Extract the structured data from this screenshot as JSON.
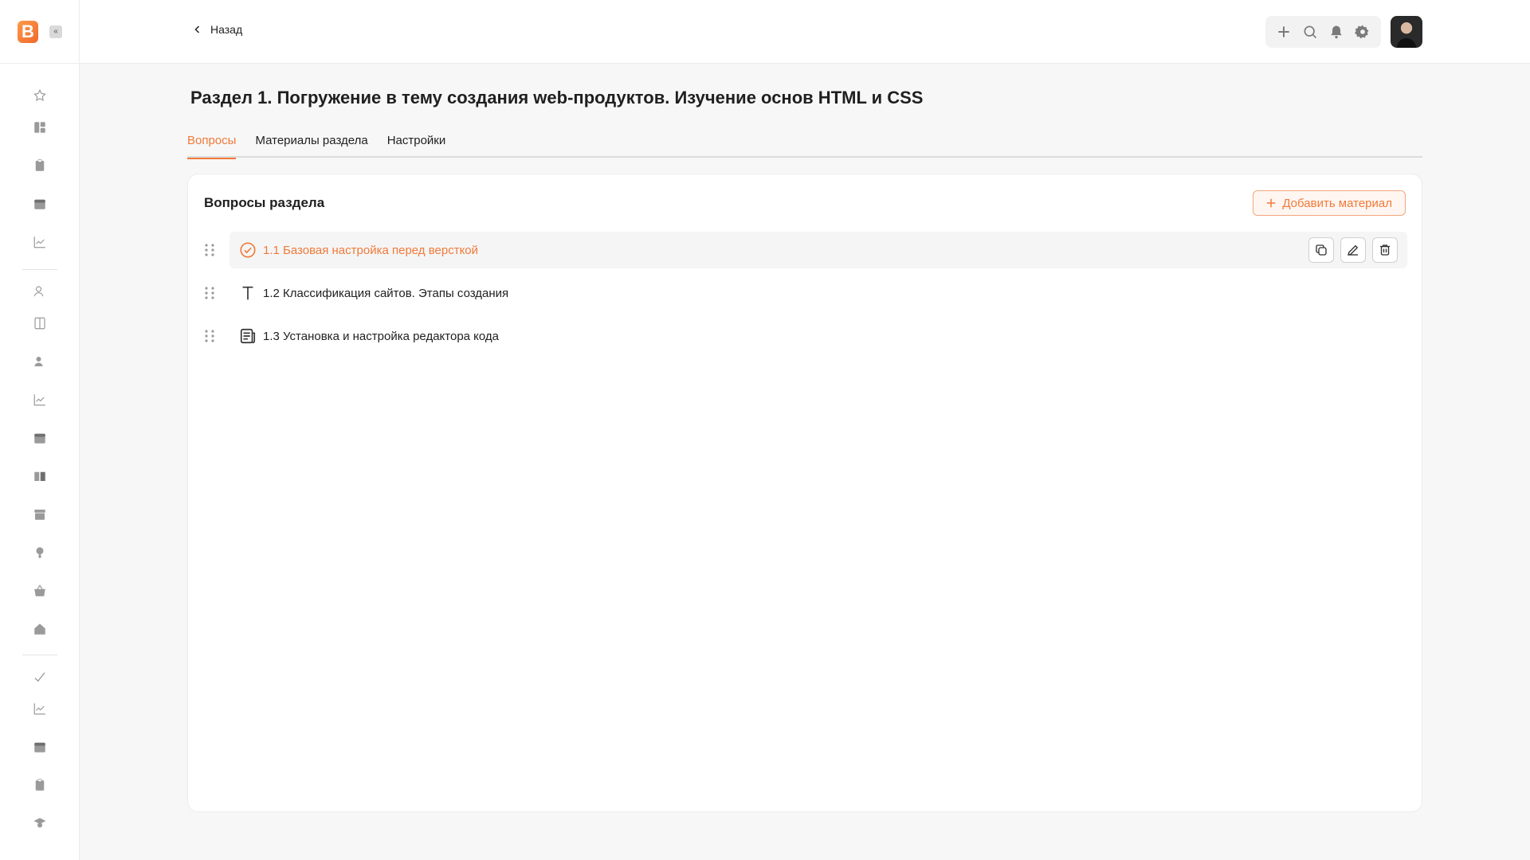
{
  "brand": {
    "logo_letter": "B",
    "accent": "#f07a3a"
  },
  "sidebar": {
    "collapse_glyph": "«",
    "items": [
      {
        "icon": "star-icon"
      },
      {
        "icon": "dashboard-icon"
      },
      {
        "icon": "clipboard-icon"
      },
      {
        "icon": "calendar-icon"
      },
      {
        "icon": "chart-icon"
      },
      {
        "icon": "users-icon"
      },
      {
        "icon": "book-icon"
      },
      {
        "icon": "user-group-icon"
      },
      {
        "icon": "chart-icon"
      },
      {
        "icon": "calendar-icon"
      },
      {
        "icon": "reader-icon"
      },
      {
        "icon": "archive-icon"
      },
      {
        "icon": "bulb-icon"
      },
      {
        "icon": "basket-icon"
      },
      {
        "icon": "home-icon"
      },
      {
        "icon": "trend-icon"
      },
      {
        "icon": "chart-icon"
      },
      {
        "icon": "calendar-icon"
      },
      {
        "icon": "clipboard-icon"
      },
      {
        "icon": "graduate-icon"
      }
    ]
  },
  "header": {
    "back_label": "Назад",
    "tools": [
      "plus-icon",
      "search-icon",
      "bell-icon",
      "gear-icon"
    ]
  },
  "page": {
    "title": "Раздел 1. Погружение в тему создания web-продуктов. Изучение основ HTML и CSS",
    "tabs": [
      {
        "label": "Вопросы",
        "active": true
      },
      {
        "label": "Материалы раздела",
        "active": false
      },
      {
        "label": "Настройки",
        "active": false
      }
    ]
  },
  "questions": {
    "title": "Вопросы раздела",
    "add_label": "Добавить материал",
    "items": [
      {
        "label": "1.1 Базовая настройка перед версткой",
        "icon": "check-circle-icon",
        "active": true
      },
      {
        "label": "1.2 Классификация сайтов. Этапы создания",
        "icon": "text-icon",
        "active": false
      },
      {
        "label": "1.3 Установка и настройка редактора кода",
        "icon": "document-icon",
        "active": false
      }
    ]
  }
}
